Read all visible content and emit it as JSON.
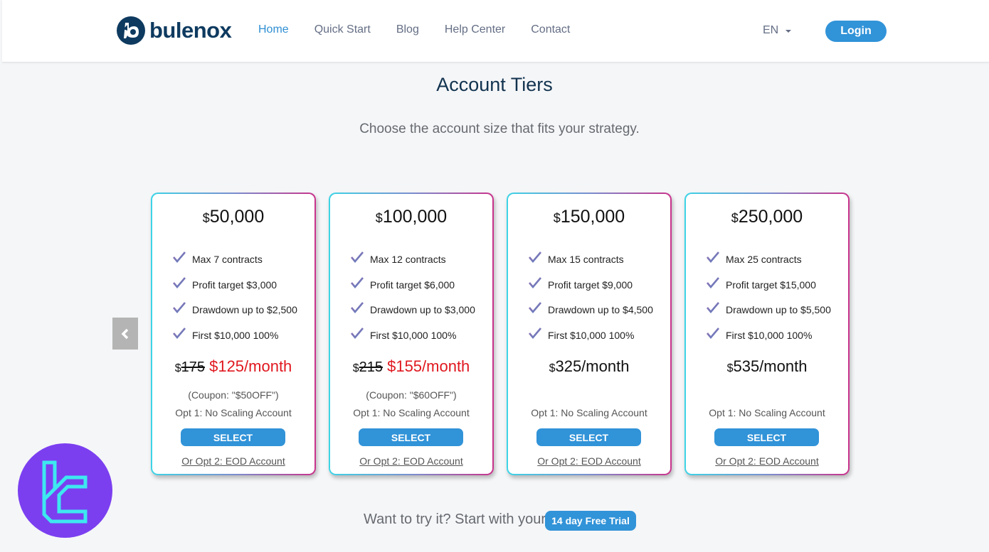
{
  "header": {
    "brand": "bulenox",
    "nav": [
      {
        "label": "Home",
        "active": true
      },
      {
        "label": "Quick Start",
        "active": false
      },
      {
        "label": "Blog",
        "active": false
      },
      {
        "label": "Help Center",
        "active": false
      },
      {
        "label": "Contact",
        "active": false
      }
    ],
    "language": "EN",
    "login_label": "Login"
  },
  "main": {
    "title": "Account Tiers",
    "subtitle": "Choose the account size that fits your strategy.",
    "currency_symbol": "$",
    "tiers": [
      {
        "amount": "50,000",
        "features": [
          "Max 7 contracts",
          "Profit target $3,000",
          "Drawdown up to $2,500",
          "First $10,000 100%"
        ],
        "old_price": "175",
        "price": "$125/month",
        "discounted": true,
        "coupon": "(Coupon: \"$50OFF\")",
        "opt1": "Opt 1: No Scaling Account",
        "select_label": "SELECT",
        "opt2": "Or Opt 2: EOD Account"
      },
      {
        "amount": "100,000",
        "features": [
          "Max 12 contracts",
          "Profit target $6,000",
          "Drawdown up to $3,000",
          "First $10,000 100%"
        ],
        "old_price": "215",
        "price": "$155/month",
        "discounted": true,
        "coupon": "(Coupon: \"$60OFF\")",
        "opt1": "Opt 1: No Scaling Account",
        "select_label": "SELECT",
        "opt2": "Or Opt 2: EOD Account"
      },
      {
        "amount": "150,000",
        "features": [
          "Max 15 contracts",
          "Profit target $9,000",
          "Drawdown up to $4,500",
          "First $10,000 100%"
        ],
        "price": "325/month",
        "discounted": false,
        "opt1": "Opt 1: No Scaling Account",
        "select_label": "SELECT",
        "opt2": "Or Opt 2: EOD Account"
      },
      {
        "amount": "250,000",
        "features": [
          "Max 25 contracts",
          "Profit target $15,000",
          "Drawdown up to $5,500",
          "First $10,000 100%"
        ],
        "price": "535/month",
        "discounted": false,
        "opt1": "Opt 1: No Scaling Account",
        "select_label": "SELECT",
        "opt2": "Or Opt 2: EOD Account"
      }
    ],
    "carousel_prev_icon": "chevron-left-icon",
    "trial_text": "Want to try it? Start with your",
    "trial_button": "14 day Free Trial"
  },
  "colors": {
    "brand": "#0e3a5f",
    "accent": "#3193d8",
    "discount_price": "#e0181f",
    "badge_bg": "#7b3ff0",
    "badge_fg": "#3de8f0"
  }
}
